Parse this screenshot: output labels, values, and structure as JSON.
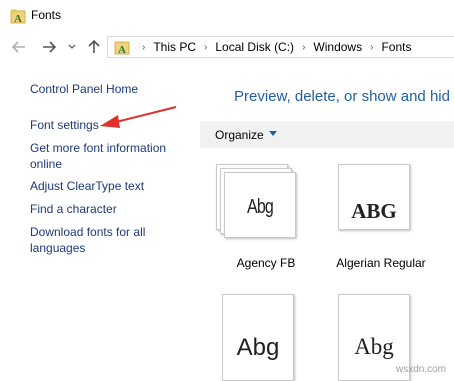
{
  "window": {
    "title": "Fonts"
  },
  "address": {
    "crumbs": [
      "This PC",
      "Local Disk (C:)",
      "Windows",
      "Fonts"
    ]
  },
  "sidebar": {
    "items": [
      {
        "label": "Control Panel Home"
      },
      {
        "label": "Font settings"
      },
      {
        "label": "Get more font information online"
      },
      {
        "label": "Adjust ClearType text"
      },
      {
        "label": "Find a character"
      },
      {
        "label": "Download fonts for all languages"
      }
    ]
  },
  "main": {
    "heading": "Preview, delete, or show and hid",
    "organize_label": "Organize",
    "fonts": [
      {
        "sample": "Abg",
        "name": "Agency FB"
      },
      {
        "sample": "ABG",
        "name": "Algerian Regular"
      },
      {
        "sample": "Abg",
        "name": ""
      },
      {
        "sample": "Abg",
        "name": ""
      }
    ]
  },
  "watermark": "wsxdn.com",
  "colors": {
    "link": "#1e3a7a",
    "heading": "#1f5fa8",
    "annotation_arrow": "#e0302c"
  }
}
